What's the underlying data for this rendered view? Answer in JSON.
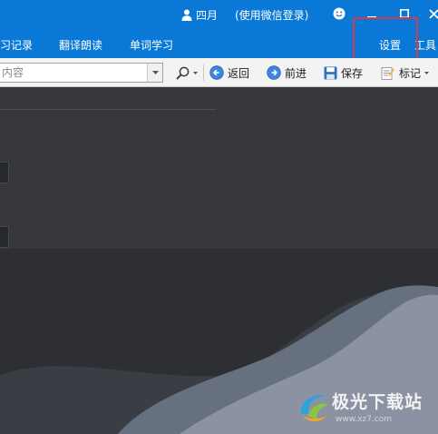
{
  "titlebar": {
    "user_name": "四月",
    "login_hint": "(使用微信登录)",
    "icons": [
      "user-icon",
      "smiley-icon",
      "minimize-icon",
      "maximize-icon",
      "close-icon"
    ]
  },
  "menubar": {
    "items": [
      "习记录",
      "翻译朗读",
      "单词学习"
    ],
    "settings_label": "设置",
    "tools_label": "工具"
  },
  "toolbar": {
    "search_placeholder": "内容",
    "back_label": "返回",
    "forward_label": "前进",
    "save_label": "保存",
    "mark_label": "标记"
  },
  "watermark": {
    "title": "极光下载站",
    "url": "www.xz7.com"
  },
  "colors": {
    "titlebar_blue": "#0a78d7",
    "highlight_red": "#d63b45",
    "content_bg": "#2d2f33",
    "wave_light": "#8b93a3"
  }
}
